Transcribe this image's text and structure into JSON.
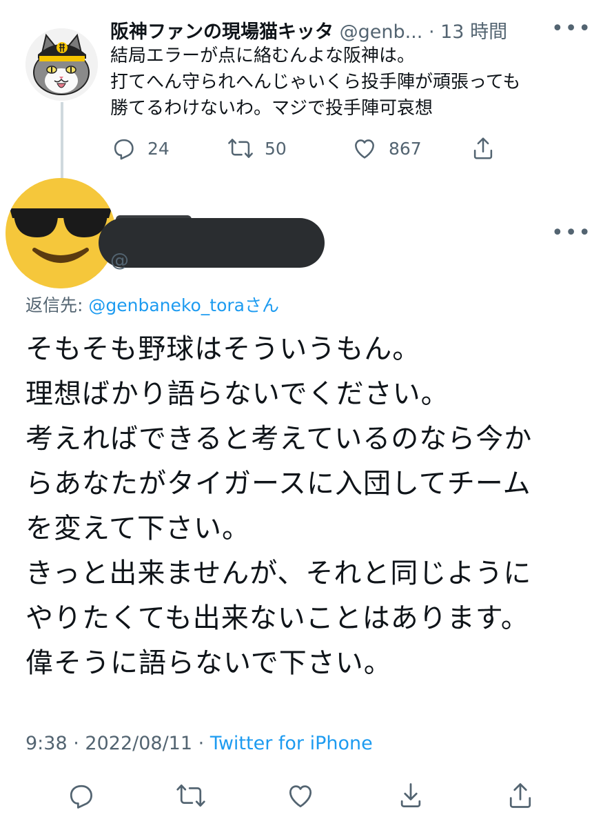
{
  "parent_tweet": {
    "display_name": "阪神ファンの現場猫キッタ",
    "handle": "@genb...",
    "separator": "·",
    "time_ago": "13 時間",
    "more_icon": "more-dots-icon",
    "text": "結局エラーが点に絡むんよな阪神は。\n打てへん守られへんじゃいくら投手陣が頑張っても\n勝てるわけないわ。マジで投手陣可哀想",
    "replies": "24",
    "retweets": "50",
    "likes": "867"
  },
  "reply_tweet": {
    "replying_prefix": "返信先:",
    "replying_handle": "@genbaneko_tora",
    "replying_suffix": "さん",
    "text": "そもそも野球はそういうもん。\n理想ばかり語らないでください。\n考えればできると考えているのなら今か\nらあなたがタイガースに入団してチーム\nを変えて下さい。\nきっと出来ませんが、それと同じように\nやりたくても出来ないことはあります。\n偉そうに語らないで下さい。",
    "time": "9:38",
    "separator": "·",
    "date": "2022/08/11",
    "separator2": "·",
    "source": "Twitter for iPhone"
  },
  "colors": {
    "accent": "#1d9bf0",
    "muted": "#536471",
    "text": "#0f1419",
    "thread_line": "#cfd9de",
    "emoji_face": "#f5c73b"
  },
  "icons": {
    "reply": "reply-icon",
    "retweet": "retweet-icon",
    "like": "like-icon",
    "share": "share-icon",
    "bookmark": "bookmark-icon"
  }
}
